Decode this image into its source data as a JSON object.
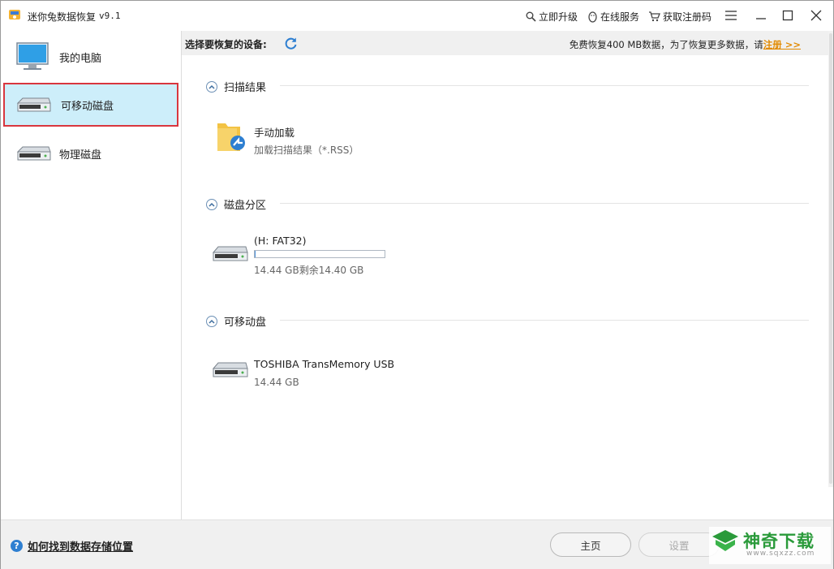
{
  "titlebar": {
    "title": "迷你兔数据恢复",
    "version": "v9.1",
    "upgrade": "立即升级",
    "online_service": "在线服务",
    "get_code": "获取注册码"
  },
  "sidebar": {
    "items": [
      {
        "label": "我的电脑",
        "icon": "monitor-icon"
      },
      {
        "label": "可移动磁盘",
        "icon": "removable-disk-icon",
        "active": true
      },
      {
        "label": "物理磁盘",
        "icon": "physical-disk-icon"
      }
    ]
  },
  "header": {
    "title": "选择要恢复的设备:",
    "promo_prefix": "免费恢复400 MB数据，为了恢复更多数据，请",
    "promo_link": "注册 >>"
  },
  "sections": {
    "scan": {
      "title": "扫描结果",
      "entry_title": "手动加载",
      "entry_sub": "加载扫描结果（*.RSS）"
    },
    "partition": {
      "title": "磁盘分区",
      "entry_title": "(H: FAT32)",
      "entry_sub": "14.44 GB剩余14.40 GB",
      "used_fraction": 0.003
    },
    "removable": {
      "title": "可移动盘",
      "entry_title": "TOSHIBA TransMemory USB",
      "entry_sub": "14.44 GB"
    }
  },
  "footer": {
    "help": "如何找到数据存储位置",
    "home_button": "主页",
    "settings_button": "设置"
  },
  "watermark": {
    "text": "神奇下载",
    "url": "www.sqxzz.com"
  },
  "colors": {
    "accent": "#2e7fd1",
    "active_bg": "#cdeefa",
    "active_border": "#d9363e",
    "link": "#e28a00",
    "watermark": "#2a9a3a"
  }
}
